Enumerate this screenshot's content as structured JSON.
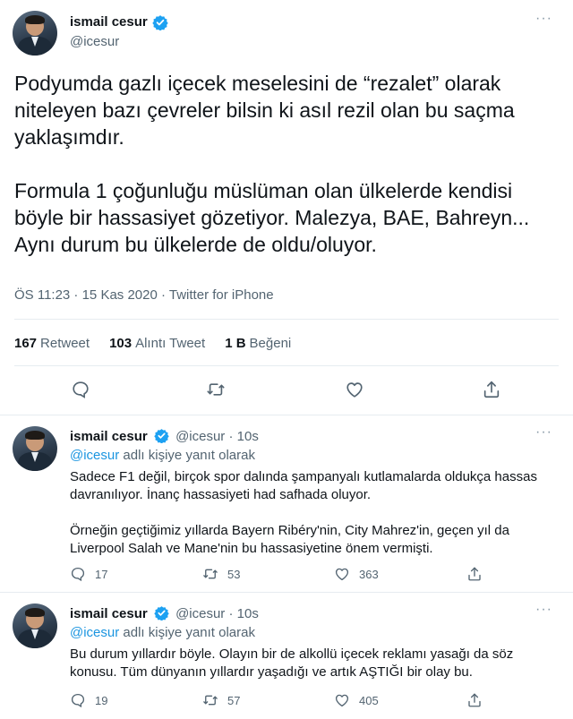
{
  "main_tweet": {
    "author_name": "ismail cesur",
    "handle": "@icesur",
    "more_label": "···",
    "paragraphs": [
      "Podyumda gazlı içecek meselesini de “rezalet” olarak niteleyen bazı çevreler bilsin ki asıl rezil olan bu saçma yaklaşımdır.",
      "Formula 1 çoğunluğu müslüman olan ülkelerde kendisi böyle bir hassasiyet gözetiyor. Malezya, BAE, Bahreyn... Aynı durum bu ülkelerde de oldu/oluyor."
    ],
    "meta": "ÖS 11:23 · 15 Kas 2020 · Twitter for iPhone",
    "stats": [
      {
        "count": "167",
        "label": "Retweet"
      },
      {
        "count": "103",
        "label": "Alıntı Tweet"
      },
      {
        "count": "1 B",
        "label": "Beğeni"
      }
    ]
  },
  "replies": [
    {
      "author_name": "ismail cesur",
      "handle_time": "@icesur · 10s",
      "reply_to_mention": "@icesur",
      "reply_to_suffix": " adlı kişiye yanıt olarak",
      "paragraphs": [
        "Sadece F1 değil, birçok spor dalında şampanyalı kutlamalarda oldukça hassas davranılıyor. İnanç hassasiyeti had safhada oluyor.",
        "Örneğin geçtiğimiz yıllarda Bayern Ribéry'nin, City Mahrez'in, geçen yıl da Liverpool Salah ve Mane'nin bu hassasiyetine önem vermişti."
      ],
      "replies_count": "17",
      "retweets_count": "53",
      "likes_count": "363"
    },
    {
      "author_name": "ismail cesur",
      "handle_time": "@icesur · 10s",
      "reply_to_mention": "@icesur",
      "reply_to_suffix": " adlı kişiye yanıt olarak",
      "paragraphs": [
        "Bu durum yıllardır böyle. Olayın bir de alkollü içecek reklamı yasağı da söz konusu. Tüm dünyanın yıllardır yaşadığı ve artık AŞTIĞI bir olay bu."
      ],
      "replies_count": "19",
      "retweets_count": "57",
      "likes_count": "405"
    }
  ],
  "colors": {
    "verified": "#1da1f2",
    "icon_gray": "#536471",
    "mention": "#1b95e0"
  },
  "icons": [
    "reply-icon",
    "retweet-icon",
    "like-icon",
    "share-icon",
    "verified-badge-icon"
  ]
}
